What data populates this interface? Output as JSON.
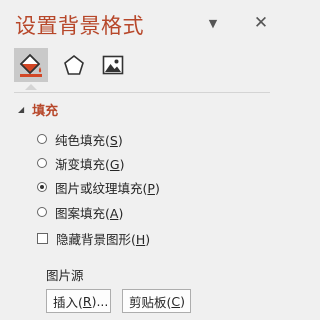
{
  "pane": {
    "title": "设置背景格式",
    "menu_glyph": "▼",
    "close_glyph": "✕",
    "accent_color": "#b7472a"
  },
  "tabs": [
    {
      "icon": "paint-bucket-icon",
      "active": true
    },
    {
      "icon": "pentagon-icon",
      "active": false
    },
    {
      "icon": "picture-icon",
      "active": false
    }
  ],
  "section": {
    "caret": "◢",
    "label": "填充"
  },
  "options": [
    {
      "text": "纯色填充(",
      "key": "S",
      "end": ")",
      "checked": false
    },
    {
      "text": "渐变填充(",
      "key": "G",
      "end": ")",
      "checked": false
    },
    {
      "text": "图片或纹理填充(",
      "key": "P",
      "end": ")",
      "checked": true
    },
    {
      "text": "图案填充(",
      "key": "A",
      "end": ")",
      "checked": false
    }
  ],
  "hide_graphics": {
    "text": "隐藏背景图形(",
    "key": "H",
    "end": ")",
    "checked": false
  },
  "picture_source": {
    "label": "图片源",
    "insert": {
      "text": "插入(",
      "key": "R",
      "end": ")..."
    },
    "clipboard": {
      "text": "剪贴板(",
      "key": "C",
      "end": ")"
    }
  }
}
